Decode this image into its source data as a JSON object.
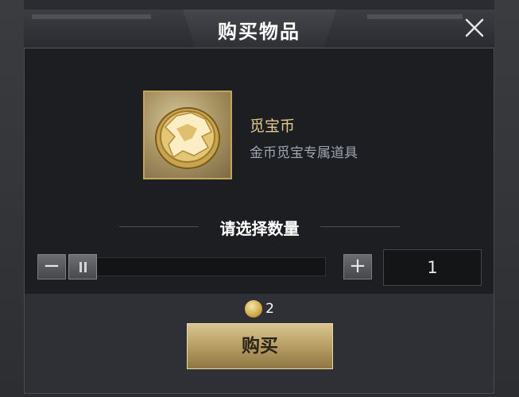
{
  "dialog": {
    "title": "购买物品",
    "close_icon": "close-icon"
  },
  "item": {
    "name": "觅宝币",
    "description": "金币觅宝专属道具",
    "icon": "treasure-coin-icon"
  },
  "quantity": {
    "label": "请选择数量",
    "value": "1",
    "decrease_label": "−",
    "increase_label": "+",
    "slider_fraction": 0
  },
  "cost": {
    "currency_icon": "gold-coin-icon",
    "amount": "2"
  },
  "buy_button": {
    "label": "购买"
  },
  "colors": {
    "accent_gold": "#c4a35c",
    "item_name": "#e2c98d",
    "item_desc": "#9ea4b0",
    "button_gold": "#b39a5f"
  }
}
